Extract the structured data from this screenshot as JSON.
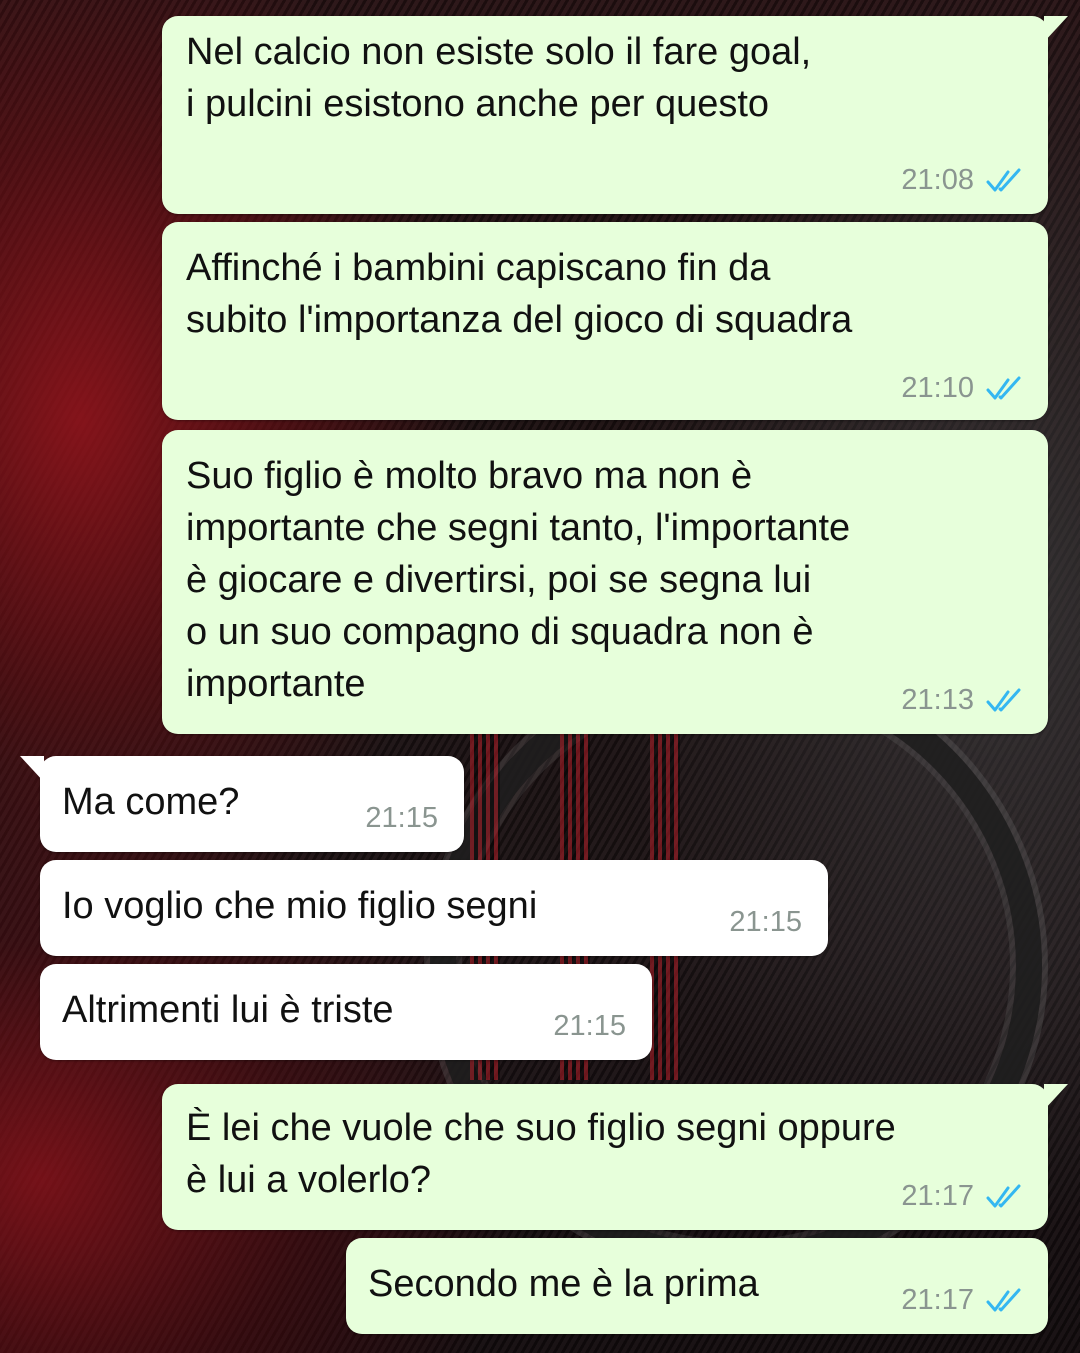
{
  "chat": {
    "messages": [
      {
        "dir": "out",
        "text": "Nel calcio non esiste solo il fare goal,\ni pulcini esistono anche per questo",
        "time": "21:08",
        "status": "read"
      },
      {
        "dir": "out",
        "text": "Affinché i bambini capiscano fin da\nsubito l'importanza del gioco di squadra",
        "time": "21:10",
        "status": "read"
      },
      {
        "dir": "out",
        "text": "Suo figlio è molto bravo ma non è\nimportante che segni tanto, l'importante\nè giocare e divertirsi, poi se segna lui\no un suo compagno di squadra non è\nimportante",
        "time": "21:13",
        "status": "read"
      },
      {
        "dir": "in",
        "text": "Ma come?",
        "time": "21:15"
      },
      {
        "dir": "in",
        "text": "Io voglio che mio figlio segni",
        "time": "21:15"
      },
      {
        "dir": "in",
        "text": "Altrimenti lui è triste",
        "time": "21:15"
      },
      {
        "dir": "out",
        "text": "È lei che vuole che suo figlio segni oppure\nè lui a volerlo?",
        "time": "21:17",
        "status": "read"
      },
      {
        "dir": "out",
        "text": "Secondo me è la prima",
        "time": "21:17",
        "status": "read"
      }
    ]
  },
  "icons": {
    "read_receipt": "double-check-icon"
  },
  "colors": {
    "outgoing_bubble": "#e7ffdb",
    "incoming_bubble": "#ffffff",
    "timestamp": "#8a9590",
    "read_check": "#34b7f1"
  }
}
